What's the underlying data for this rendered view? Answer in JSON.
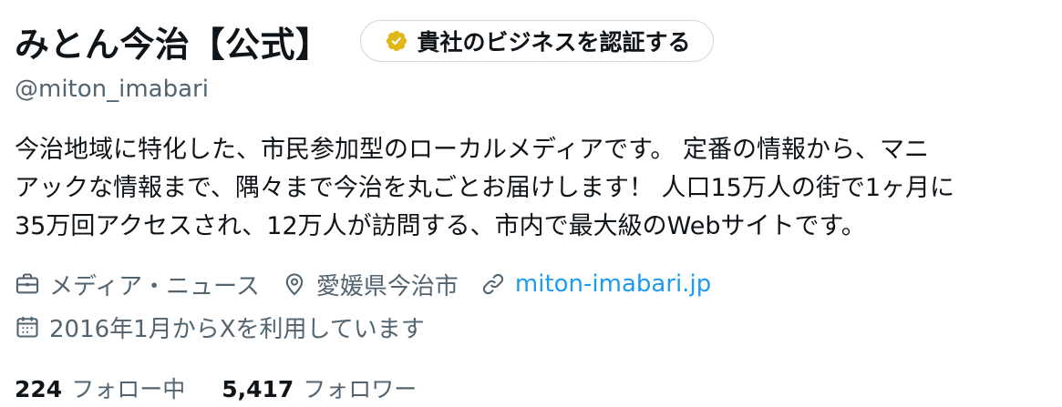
{
  "profile": {
    "display_name": "みとん今治【公式】",
    "verify_button_label": "貴社のビジネスを認証する",
    "handle": "@miton_imabari",
    "bio": "今治地域に特化した、市民参加型のローカルメディアです。 定番の情報から、マニ\nアックな情報まで、隅々まで今治を丸ごとお届けします！ 人口15万人の街で1ヶ月に\n35万回アクセスされ、12万人が訪問する、市内で最大級のWebサイトです。",
    "category": "メディア・ニュース",
    "location": "愛媛県今治市",
    "website": "miton-imabari.jp",
    "joined": "2016年1月からXを利用しています",
    "following_count": "224",
    "following_label": "フォロー中",
    "followers_count": "5,417",
    "followers_label": "フォロワー"
  },
  "icons": {
    "verify_badge": "gold-check-badge-icon",
    "category": "briefcase-icon",
    "location": "location-pin-icon",
    "website": "link-icon",
    "joined": "calendar-icon"
  },
  "colors": {
    "text_primary": "#0f1419",
    "text_secondary": "#536471",
    "link": "#1d9bf0",
    "badge_gold": "#e2b719",
    "button_border": "#cfd9de"
  }
}
